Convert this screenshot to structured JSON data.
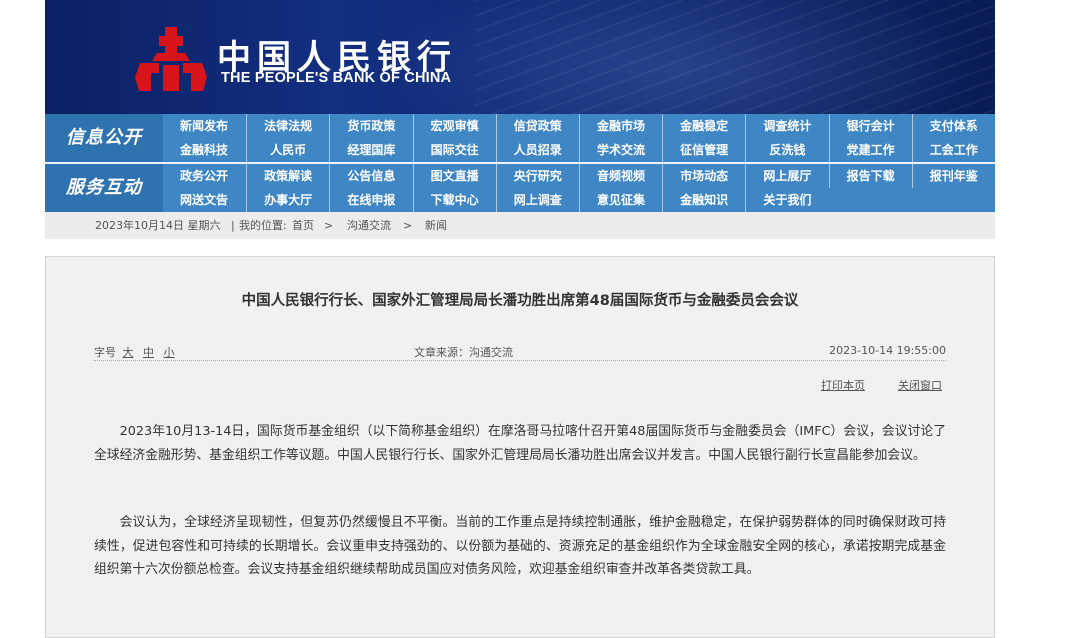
{
  "header": {
    "logo_cn": "中国人民银行",
    "logo_en": "THE PEOPLE'S BANK OF CHINA"
  },
  "nav": {
    "section1": {
      "label": "信息公开",
      "row1": [
        "新闻发布",
        "法律法规",
        "货币政策",
        "宏观审慎",
        "信贷政策",
        "金融市场",
        "金融稳定",
        "调查统计",
        "银行会计",
        "支付体系"
      ],
      "row2": [
        "金融科技",
        "人民币",
        "经理国库",
        "国际交往",
        "人员招录",
        "学术交流",
        "征信管理",
        "反洗钱",
        "党建工作",
        "工会工作"
      ]
    },
    "section2": {
      "label": "服务互动",
      "row1": [
        "政务公开",
        "政策解读",
        "公告信息",
        "图文直播",
        "央行研究",
        "音频视频",
        "市场动态",
        "网上展厅",
        "报告下载",
        "报刊年鉴"
      ],
      "row2": [
        "网送文告",
        "办事大厅",
        "在线申报",
        "下载中心",
        "网上调查",
        "意见征集",
        "金融知识",
        "关于我们"
      ]
    }
  },
  "breadcrumb": {
    "date": "2023年10月14日  星期六",
    "location_label": "我的位置:",
    "path": [
      "首页",
      "沟通交流",
      "新闻"
    ]
  },
  "article": {
    "title": "中国人民银行行长、国家外汇管理局局长潘功胜出席第48届国际货币与金融委员会会议",
    "font_label": "字号",
    "font_sizes": [
      "大",
      "中",
      "小"
    ],
    "source": "文章来源：沟通交流",
    "datetime": "2023-10-14 19:55:00",
    "print_label": "打印本页",
    "close_label": "关闭窗口",
    "paragraphs": [
      "2023年10月13-14日，国际货币基金组织（以下简称基金组织）在摩洛哥马拉喀什召开第48届国际货币与金融委员会（IMFC）会议，会议讨论了全球经济金融形势、基金组织工作等议题。中国人民银行行长、国家外汇管理局局长潘功胜出席会议并发言。中国人民银行副行长宣昌能参加会议。",
      "会议认为，全球经济呈现韧性，但复苏仍然缓慢且不平衡。当前的工作重点是持续控制通胀，维护金融稳定，在保护弱势群体的同时确保财政可持续性，促进包容性和可持续的长期增长。会议重申支持强劲的、以份额为基础的、资源充足的基金组织作为全球金融安全网的核心，承诺按期完成基金组织第十六次份额总检查。会议支持基金组织继续帮助成员国应对债务风险，欢迎基金组织审查并改革各类贷款工具。"
    ]
  },
  "colors": {
    "banner": "#0e2a73",
    "nav": "#3f86c4",
    "nav_label": "#2f72b0",
    "logo_red": "#d7141a"
  }
}
